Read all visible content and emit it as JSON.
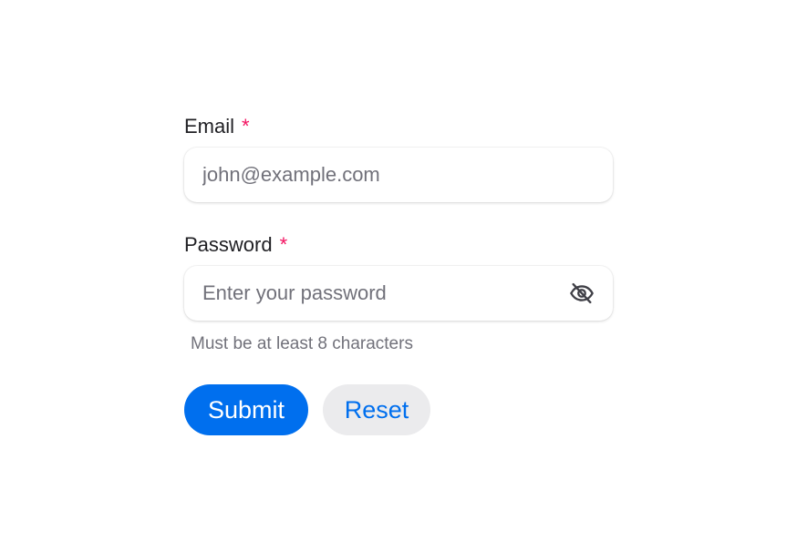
{
  "form": {
    "email": {
      "label": "Email",
      "required_marker": "*",
      "placeholder": "john@example.com",
      "value": ""
    },
    "password": {
      "label": "Password",
      "required_marker": "*",
      "placeholder": "Enter your password",
      "value": "",
      "helper": "Must be at least 8 characters",
      "toggle_icon": "eye-slash-icon"
    },
    "buttons": {
      "submit_label": "Submit",
      "reset_label": "Reset"
    }
  },
  "colors": {
    "primary": "#006fee",
    "danger": "#f31260",
    "muted": "#71717a",
    "flat_bg": "#ebebed"
  }
}
